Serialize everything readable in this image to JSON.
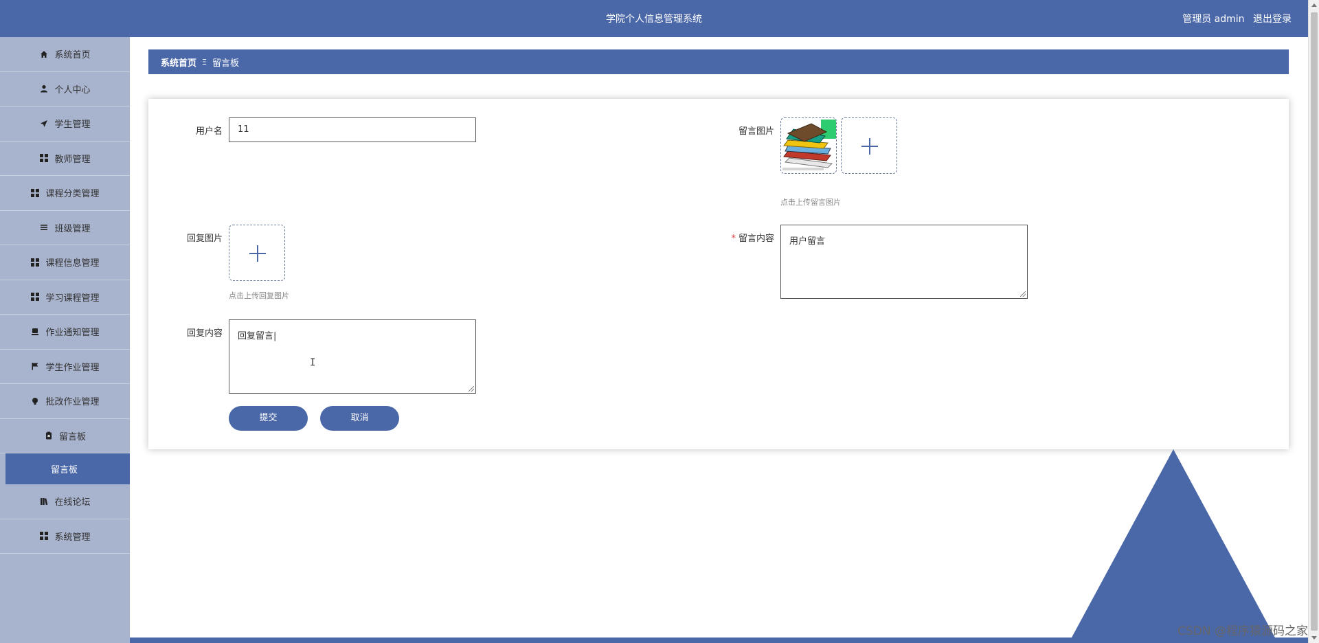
{
  "header": {
    "title": "学院个人信息管理系统",
    "user_label": "管理员 admin",
    "logout_label": "退出登录"
  },
  "sidebar": {
    "items": [
      {
        "label": "系统首页",
        "icon": "home-icon"
      },
      {
        "label": "个人中心",
        "icon": "user-icon"
      },
      {
        "label": "学生管理",
        "icon": "send-icon"
      },
      {
        "label": "教师管理",
        "icon": "grid-icon"
      },
      {
        "label": "课程分类管理",
        "icon": "grid-icon"
      },
      {
        "label": "班级管理",
        "icon": "list-icon"
      },
      {
        "label": "课程信息管理",
        "icon": "grid-icon"
      },
      {
        "label": "学习课程管理",
        "icon": "grid-icon"
      },
      {
        "label": "作业通知管理",
        "icon": "stamp-icon"
      },
      {
        "label": "学生作业管理",
        "icon": "flag-icon"
      },
      {
        "label": "批改作业管理",
        "icon": "bulb-icon"
      },
      {
        "label": "留言板",
        "icon": "clipboard-icon"
      },
      {
        "label": "留言板",
        "icon": ""
      },
      {
        "label": "在线论坛",
        "icon": "book-icon"
      },
      {
        "label": "系统管理",
        "icon": "grid-icon"
      }
    ]
  },
  "breadcrumb": {
    "home": "系统首页",
    "separator": "Ξ",
    "current": "留言板"
  },
  "form": {
    "username_label": "用户名",
    "username_value": "11",
    "message_image_label": "留言图片",
    "message_image_hint": "点击上传留言图片",
    "reply_image_label": "回复图片",
    "reply_image_hint": "点击上传回复图片",
    "message_content_required": "*",
    "message_content_label": "留言内容",
    "message_content_value": "用户留言",
    "reply_content_label": "回复内容",
    "reply_content_value": "回复留言|",
    "submit_label": "提交",
    "cancel_label": "取消"
  },
  "watermark": "CSDN @程序猿源码之家",
  "colors": {
    "primary": "#4a67a8",
    "sidebar_bg": "#a8b3cd",
    "required": "#e64242"
  }
}
